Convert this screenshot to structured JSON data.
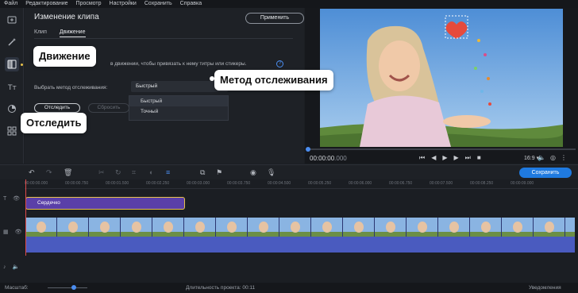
{
  "menu": [
    "Файл",
    "Редактирование",
    "Просмотр",
    "Настройки",
    "Сохранить",
    "Справка"
  ],
  "panel": {
    "title": "Изменение клипа",
    "apply": "Применить",
    "tabs": [
      "Клип",
      "Движение"
    ],
    "description": "в движении, чтобы привязать к нему титры или стикеры.",
    "help": "?",
    "method_label": "Выбрать метод отслеживания:",
    "method_value": "Быстрый",
    "method_options": [
      "Быстрый",
      "Точный"
    ],
    "track_button": "Отследить",
    "reset_button": "Сбросить"
  },
  "callouts": {
    "motion": "Движение",
    "method": "Метод отслеживания",
    "track": "Отследить"
  },
  "player": {
    "time_main": "00:00:00",
    "time_ms": ".000",
    "ratio": "16:9 ▾",
    "controls": [
      "⏮",
      "◀",
      "▶",
      "▶",
      "⏭",
      "■"
    ]
  },
  "toolbar": {
    "save": "Сохранить"
  },
  "timeline": {
    "ruler": [
      "00:00:00.000",
      "00:00:00.750",
      "00:00:01.500",
      "00:00:02.250",
      "00:00:03.000",
      "00:00:03.750",
      "00:00:04.500",
      "00:00:05.250",
      "00:00:06.000",
      "00:00:06.750",
      "00:00:07.500",
      "00:00:08.250",
      "00:00:09.000"
    ],
    "title_clip": "Сердечко"
  },
  "status": {
    "zoom_label": "Масштаб:",
    "duration": "Длительность проекта: 00:11",
    "notifications": "Уведомления"
  },
  "colors": {
    "accent": "#1f7ae0",
    "title_clip": "#5a3fa8",
    "video_track": "#3a4ea0",
    "playhead": "#e04a4a"
  }
}
